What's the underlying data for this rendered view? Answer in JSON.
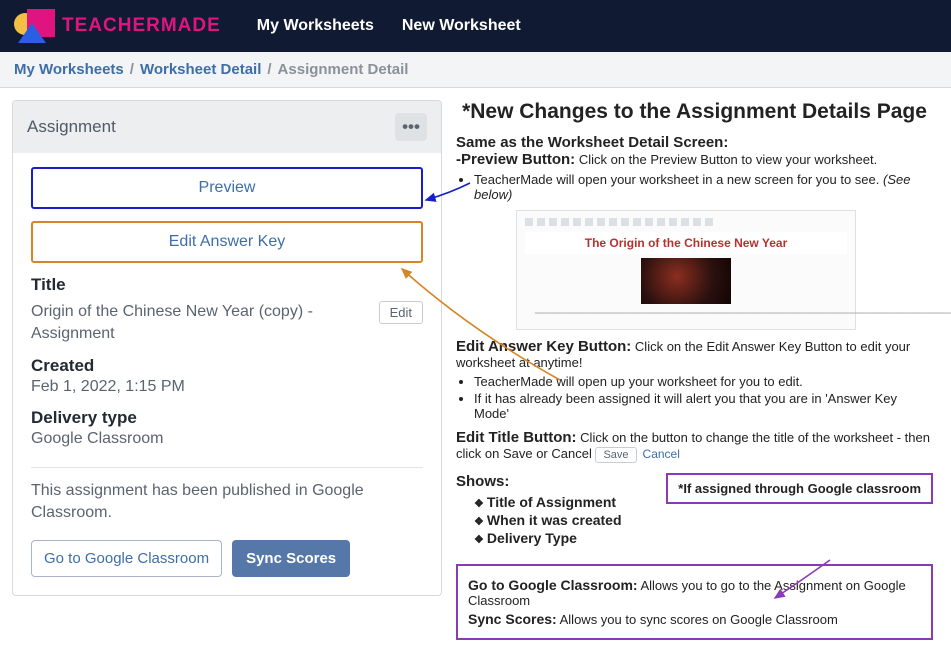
{
  "nav": {
    "brand": "TEACHERMADE",
    "items": [
      "My Worksheets",
      "New Worksheet"
    ]
  },
  "breadcrumbs": {
    "link1": "My Worksheets",
    "link2": "Worksheet Detail",
    "current": "Assignment Detail"
  },
  "panel": {
    "header": "Assignment",
    "preview_btn": "Preview",
    "answerkey_btn": "Edit Answer Key",
    "title_label": "Title",
    "title_value": "Origin of the Chinese New Year (copy) - Assignment",
    "edit_btn": "Edit",
    "created_label": "Created",
    "created_value": "Feb 1, 2022, 1:15 PM",
    "delivery_label": "Delivery type",
    "delivery_value": "Google Classroom",
    "published_note": "This assignment has been published in Google Classroom.",
    "go_btn": "Go to Google Classroom",
    "sync_btn": "Sync Scores"
  },
  "annotations": {
    "heading": "*New Changes to the Assignment Details Page",
    "same_as": "Same as the Worksheet Detail Screen:",
    "preview_label": "-Preview Button:",
    "preview_text": "Click on the Preview Button to view your worksheet.",
    "preview_bullet": "TeacherMade will open your worksheet in a new screen for you to see.",
    "preview_see_below": "(See below)",
    "mini_title": "The Origin of the Chinese New Year",
    "edit_ak_label": "Edit Answer Key Button:",
    "edit_ak_text": "Click on the Edit Answer Key Button to edit your worksheet at anytime!",
    "edit_ak_b1": "TeacherMade will open up your worksheet for you to edit.",
    "edit_ak_b2": "If it has already been assigned it will alert you that you are in 'Answer Key Mode'",
    "edit_title_label": "Edit Title Button:",
    "edit_title_text": "Click on the button to change the title of the worksheet - then click on Save or Cancel",
    "save_btn": "Save",
    "cancel_link": "Cancel",
    "shows_label": "Shows:",
    "shows_items": [
      "Title of Assignment",
      "When it was created",
      "Delivery Type"
    ],
    "purple_note": "*If assigned through Google classroom",
    "go_label": "Go to Google Classroom:",
    "go_text": "Allows you to go to the Assignment on Google Classroom",
    "sync_label": "Sync Scores:",
    "sync_text": "Allows you to sync scores on Google Classroom"
  }
}
